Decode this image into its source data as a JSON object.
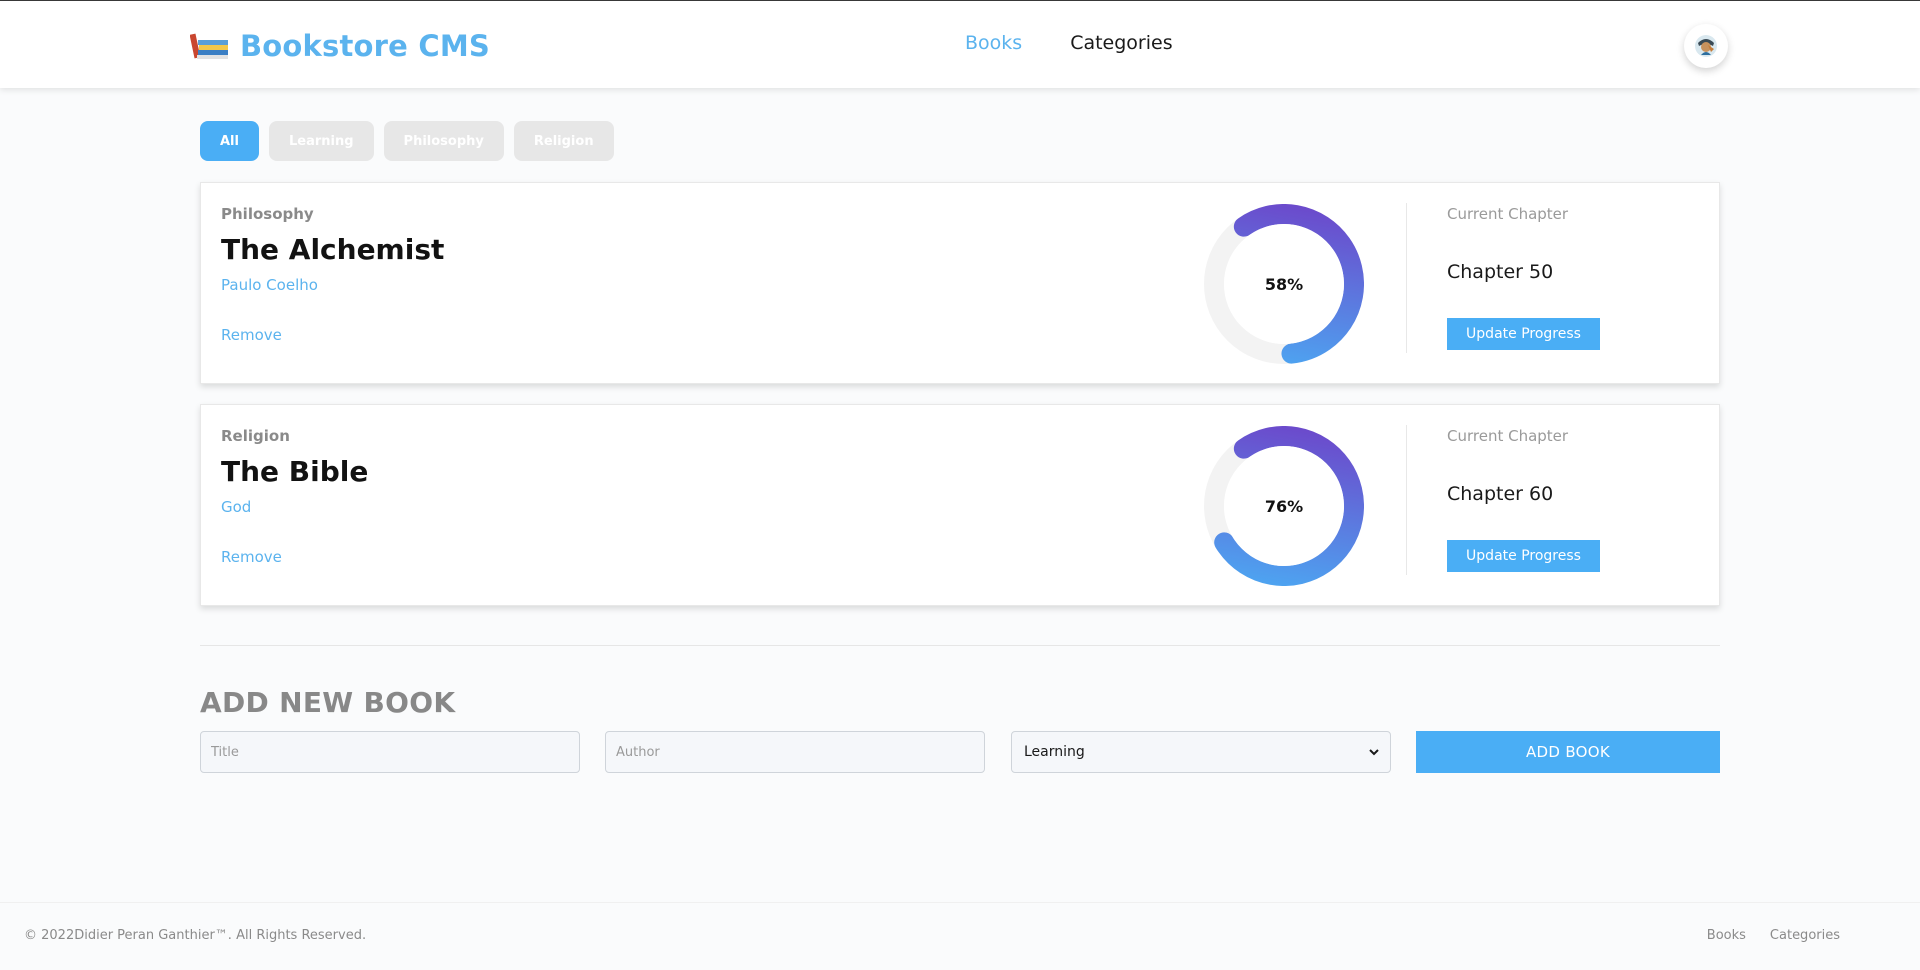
{
  "header": {
    "brand": "Bookstore CMS",
    "nav": [
      {
        "label": "Books",
        "active": true
      },
      {
        "label": "Categories",
        "active": false
      }
    ]
  },
  "filters": [
    "All",
    "Learning",
    "Philosophy",
    "Religion"
  ],
  "books": [
    {
      "category": "Philosophy",
      "title": "The Alchemist",
      "author": "Paulo Coelho",
      "remove_label": "Remove",
      "progress_percent": 58,
      "progress_label": "58%",
      "chapter_label": "Current Chapter",
      "chapter": "Chapter 50",
      "update_label": "Update Progress"
    },
    {
      "category": "Religion",
      "title": "The Bible",
      "author": "God",
      "remove_label": "Remove",
      "progress_percent": 76,
      "progress_label": "76%",
      "chapter_label": "Current Chapter",
      "chapter": "Chapter 60",
      "update_label": "Update Progress"
    }
  ],
  "add_form": {
    "heading": "ADD NEW BOOK",
    "title_placeholder": "Title",
    "author_placeholder": "Author",
    "category_selected": "Learning",
    "submit_label": "ADD BOOK"
  },
  "footer": {
    "copyright": "© 2022Didier Peran Ganthier™. All Rights Reserved.",
    "links": [
      "Books",
      "Categories"
    ]
  },
  "colors": {
    "accent": "#4aaef5",
    "brand": "#5bb3ee",
    "progress_start": "#4aaef5",
    "progress_end": "#6f3fc7"
  },
  "icons": {
    "brand_logo": "books-stack-icon",
    "avatar": "user-avatar-icon",
    "select": "chevron-down-icon"
  }
}
